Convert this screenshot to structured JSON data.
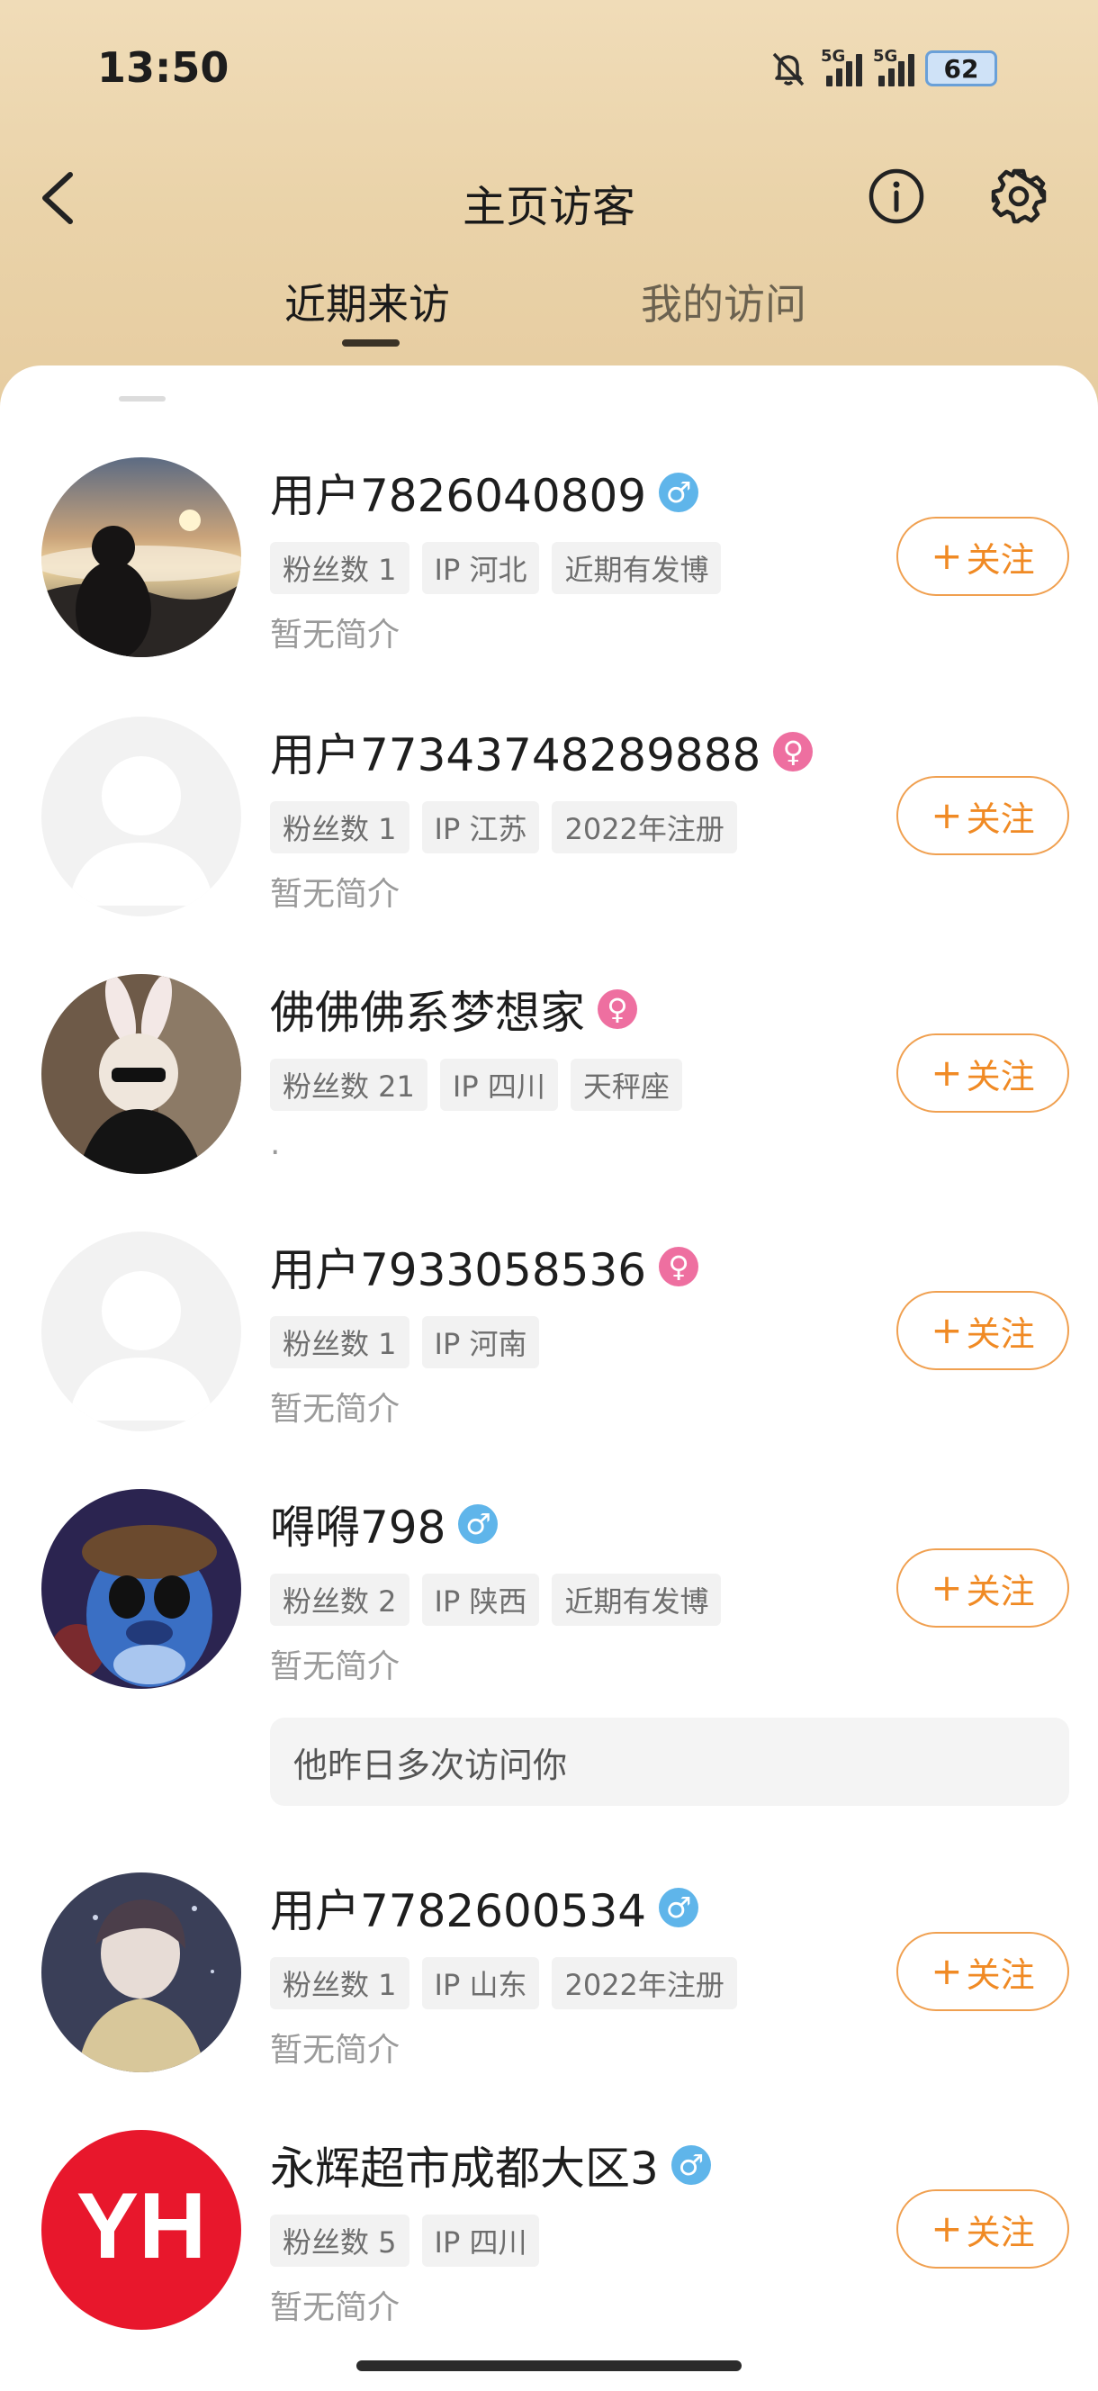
{
  "status_bar": {
    "time": "13:50",
    "network1": "5G",
    "network2": "5G",
    "battery": "62"
  },
  "header": {
    "title": "主页访客",
    "back_icon": "back-arrow-icon",
    "info_icon": "info-icon",
    "settings_icon": "gear-icon"
  },
  "tabs": [
    {
      "label": "近期来访",
      "active": true
    },
    {
      "label": "我的访问",
      "active": false
    }
  ],
  "follow_label": "关注",
  "visitors": [
    {
      "name": "用户7826040809",
      "gender": "male",
      "gender_symbol": "♂",
      "tags": [
        "粉丝数 1",
        "IP 河北",
        "近期有发博"
      ],
      "bio": "暂无简介",
      "avatar": "photo-sunset"
    },
    {
      "name": "用户77343748289888",
      "gender": "female",
      "gender_symbol": "♀",
      "tags": [
        "粉丝数 1",
        "IP 江苏",
        "2022年注册"
      ],
      "bio": "暂无简介",
      "avatar": "default"
    },
    {
      "name": "佛佛佛系梦想家",
      "gender": "female",
      "gender_symbol": "♀",
      "tags": [
        "粉丝数 21",
        "IP 四川",
        "天秤座"
      ],
      "bio": ".",
      "avatar": "photo-bunny"
    },
    {
      "name": "用户7933058536",
      "gender": "female",
      "gender_symbol": "♀",
      "tags": [
        "粉丝数 1",
        "IP 河南"
      ],
      "bio": "暂无简介",
      "avatar": "default"
    },
    {
      "name": "嘚嘚798",
      "gender": "male",
      "gender_symbol": "♂",
      "tags": [
        "粉丝数 2",
        "IP 陕西",
        "近期有发博"
      ],
      "bio": "暂无简介",
      "avatar": "photo-stitch"
    },
    {
      "name": "用户7782600534",
      "gender": "male",
      "gender_symbol": "♂",
      "tags": [
        "粉丝数 1",
        "IP 山东",
        "2022年注册"
      ],
      "bio": "暂无简介",
      "avatar": "photo-anime"
    },
    {
      "name": "永辉超市成都大区3",
      "gender": "male",
      "gender_symbol": "♂",
      "tags": [
        "粉丝数 5",
        "IP 四川"
      ],
      "bio": "暂无简介",
      "avatar": "logo-yh",
      "avatar_text": "YH"
    }
  ],
  "notice": "他昨日多次访问你",
  "colors": {
    "accent_orange": "#f08a24",
    "male_blue": "#5fb5ea",
    "female_pink": "#ee6fa0",
    "header_gold": "#ead3a9"
  }
}
